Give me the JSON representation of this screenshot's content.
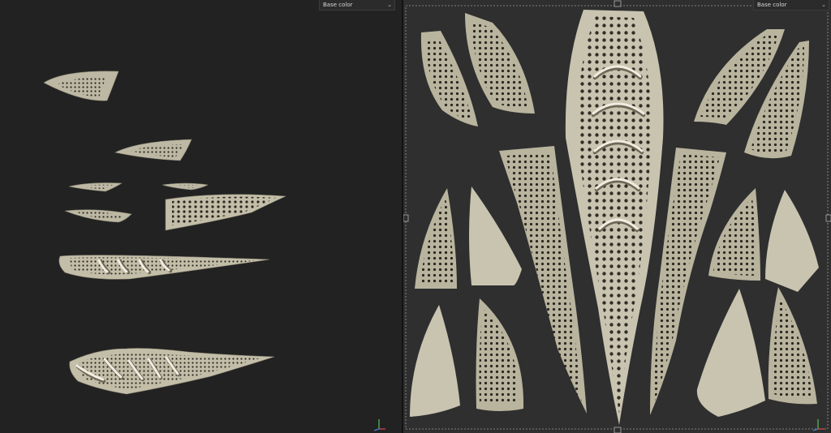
{
  "viewport_3d": {
    "channel_label": "Base color",
    "axis_gizmo": "axis-gizmo-icon"
  },
  "viewport_2d": {
    "channel_label": "Base color",
    "axis_gizmo": "axis-gizmo-icon"
  },
  "colors": {
    "bg_3d": "#222222",
    "bg_2d": "#2f2f2f",
    "shell": "#bdb8a3",
    "dots": "#2a2620"
  }
}
